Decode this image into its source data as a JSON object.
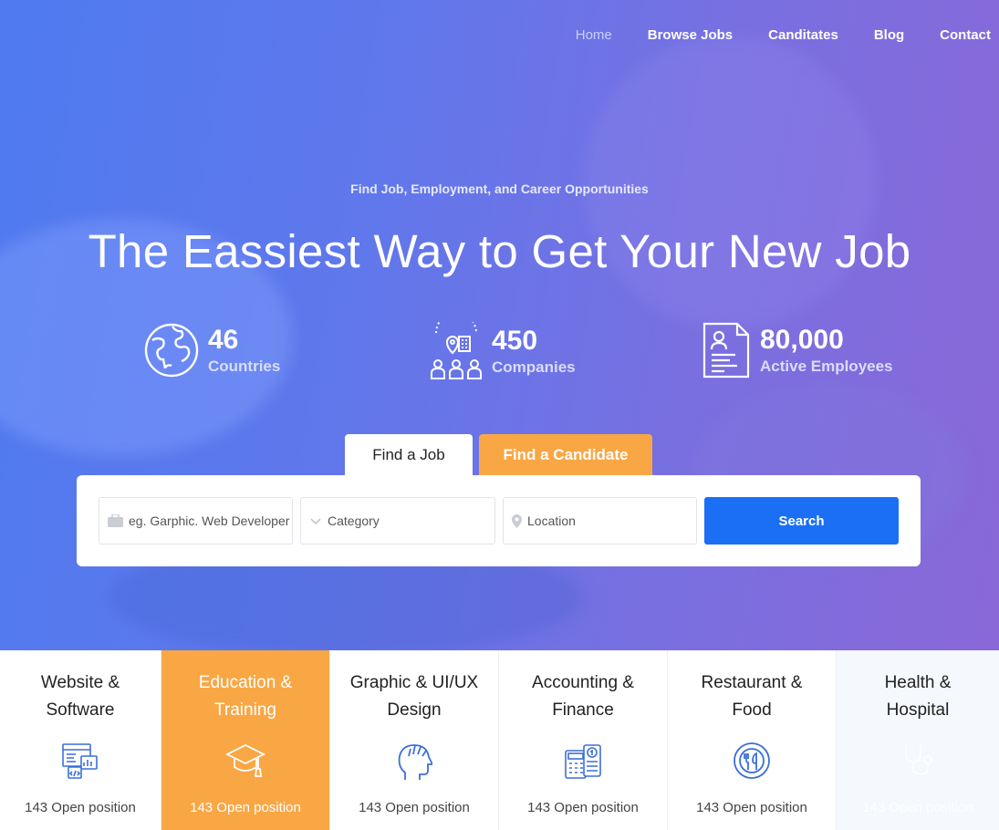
{
  "nav": {
    "items": [
      {
        "label": "Home",
        "active": true
      },
      {
        "label": "Browse Jobs"
      },
      {
        "label": "Canditates"
      },
      {
        "label": "Blog"
      },
      {
        "label": "Contact"
      }
    ]
  },
  "hero": {
    "subtitle": "Find Job, Employment, and Career Opportunities",
    "headline": "The Eassiest Way to Get Your New Job",
    "stats": [
      {
        "number": "46",
        "label": "Countries",
        "icon": "globe-icon"
      },
      {
        "number": "450",
        "label": "Companies",
        "icon": "companies-icon"
      },
      {
        "number": "80,000",
        "label": "Active Employees",
        "icon": "resume-icon"
      }
    ]
  },
  "search": {
    "tabs": {
      "find_job": "Find a Job",
      "find_candidate": "Find a Candidate"
    },
    "keyword_placeholder": "eg. Garphic. Web Developer",
    "category_placeholder": "Category",
    "location_placeholder": "Location",
    "button": "Search"
  },
  "categories": [
    {
      "title_line1": "Website &",
      "title_line2": "Software",
      "count": "143 Open position",
      "icon": "web-software-icon"
    },
    {
      "title_line1": "Education &",
      "title_line2": "Training",
      "count": "143 Open position",
      "icon": "graduation-cap-icon"
    },
    {
      "title_line1": "Graphic & UI/UX",
      "title_line2": "Design",
      "count": "143 Open position",
      "icon": "creative-head-icon"
    },
    {
      "title_line1": "Accounting &",
      "title_line2": "Finance",
      "count": "143 Open position",
      "icon": "calculator-icon"
    },
    {
      "title_line1": "Restaurant &",
      "title_line2": "Food",
      "count": "143 Open position",
      "icon": "restaurant-icon"
    },
    {
      "title_line1": "Health &",
      "title_line2": "Hospital",
      "count": "143 Open position",
      "icon": "stethoscope-icon"
    }
  ],
  "colors": {
    "accent_orange": "#f9a745",
    "primary_blue": "#1a6ff5",
    "hero_start": "#4f7af0",
    "hero_end": "#8a68d8"
  }
}
